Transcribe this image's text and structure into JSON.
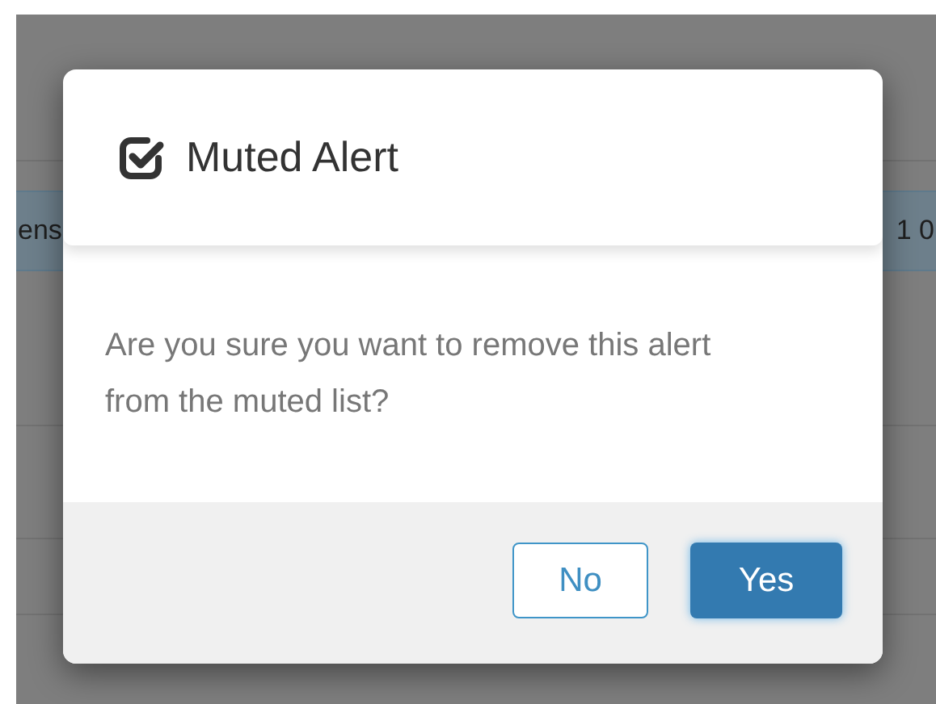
{
  "background_row": {
    "cell_1": "ens",
    "cell_2": "1 0"
  },
  "dialog": {
    "title": "Muted Alert",
    "message": "Are you sure you want to remove this alert from the muted list?",
    "buttons": [
      {
        "label": "No",
        "kind": "secondary"
      },
      {
        "label": "Yes",
        "kind": "primary"
      }
    ]
  }
}
